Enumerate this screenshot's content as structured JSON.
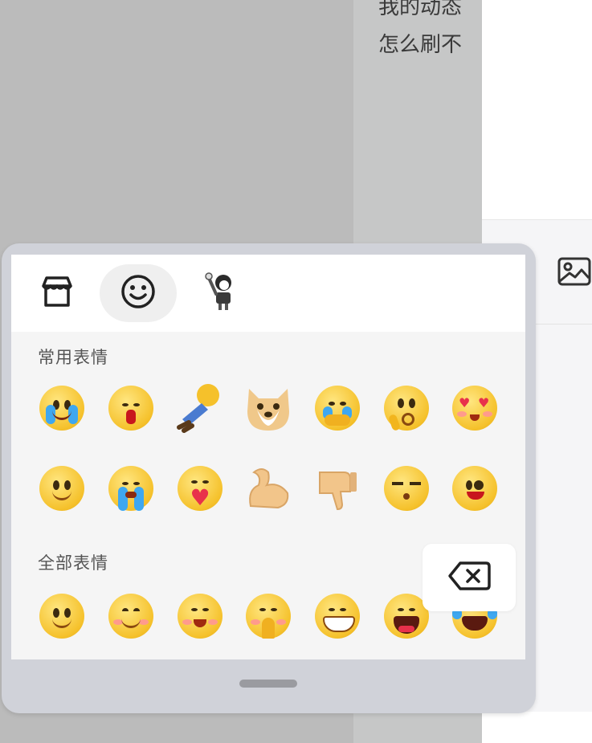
{
  "background": {
    "text_lines": [
      "我的动态",
      "怎么刷不"
    ]
  },
  "emoji_panel": {
    "tabs": [
      {
        "name": "store",
        "icon": "store-icon"
      },
      {
        "name": "emoji",
        "icon": "smiley-icon",
        "active": true
      },
      {
        "name": "sticker",
        "icon": "girl-sticker-icon"
      }
    ],
    "section_common": "常用表情",
    "section_all": "全部表情",
    "common_row1": [
      "crying",
      "nosebleed",
      "collapsed",
      "shiba-dog",
      "touched",
      "thinking",
      "heart-eyes"
    ],
    "common_row2": [
      "smile",
      "sob",
      "hug-heart",
      "flex-arm",
      "thumbs-down",
      "unamused",
      "tongue-out"
    ],
    "all_row1": [
      "smile",
      "blush",
      "shy",
      "pray",
      "grin",
      "laugh",
      "tears-of-joy"
    ]
  },
  "colors": {
    "accent_yellow": "#f5c12b",
    "tear_blue": "#3ea7f0",
    "heart_red": "#e8314b"
  }
}
